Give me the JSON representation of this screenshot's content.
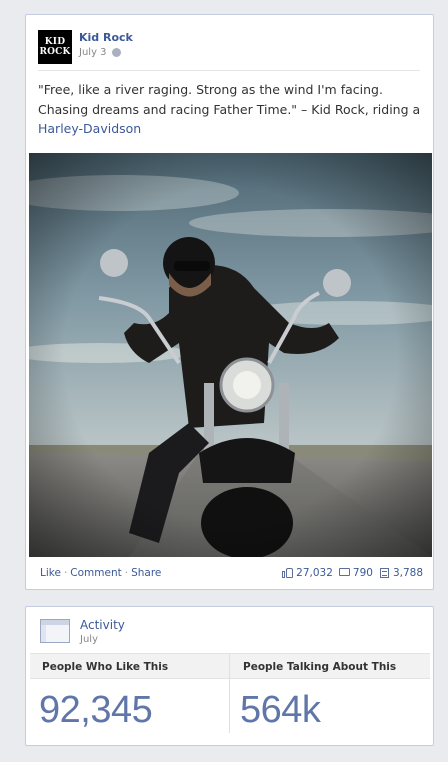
{
  "post": {
    "page_name": "Kid Rock",
    "avatar_text_line1": "KID",
    "avatar_text_line2": "ROCK",
    "date": "July 3",
    "text": "\"Free, like a river raging. Strong as the wind I'm facing. Chasing dreams and racing Father Time.\" – Kid Rock, riding a ",
    "link_text": "Harley-Davidson",
    "actions": {
      "like": "Like",
      "comment": "Comment",
      "share": "Share"
    },
    "stats": {
      "likes": "27,032",
      "comments": "790",
      "shares": "3,788"
    }
  },
  "activity": {
    "title": "Activity",
    "subtitle": "July",
    "likes_label": "People Who Like This",
    "talking_label": "People Talking About This",
    "likes_value": "92,345",
    "talking_value": "564k"
  },
  "colors": {
    "link": "#3b5998",
    "metric": "#6076a8"
  },
  "icons": [
    "globe-icon",
    "thumbs-up-icon",
    "comment-icon",
    "share-icon",
    "activity-icon"
  ]
}
